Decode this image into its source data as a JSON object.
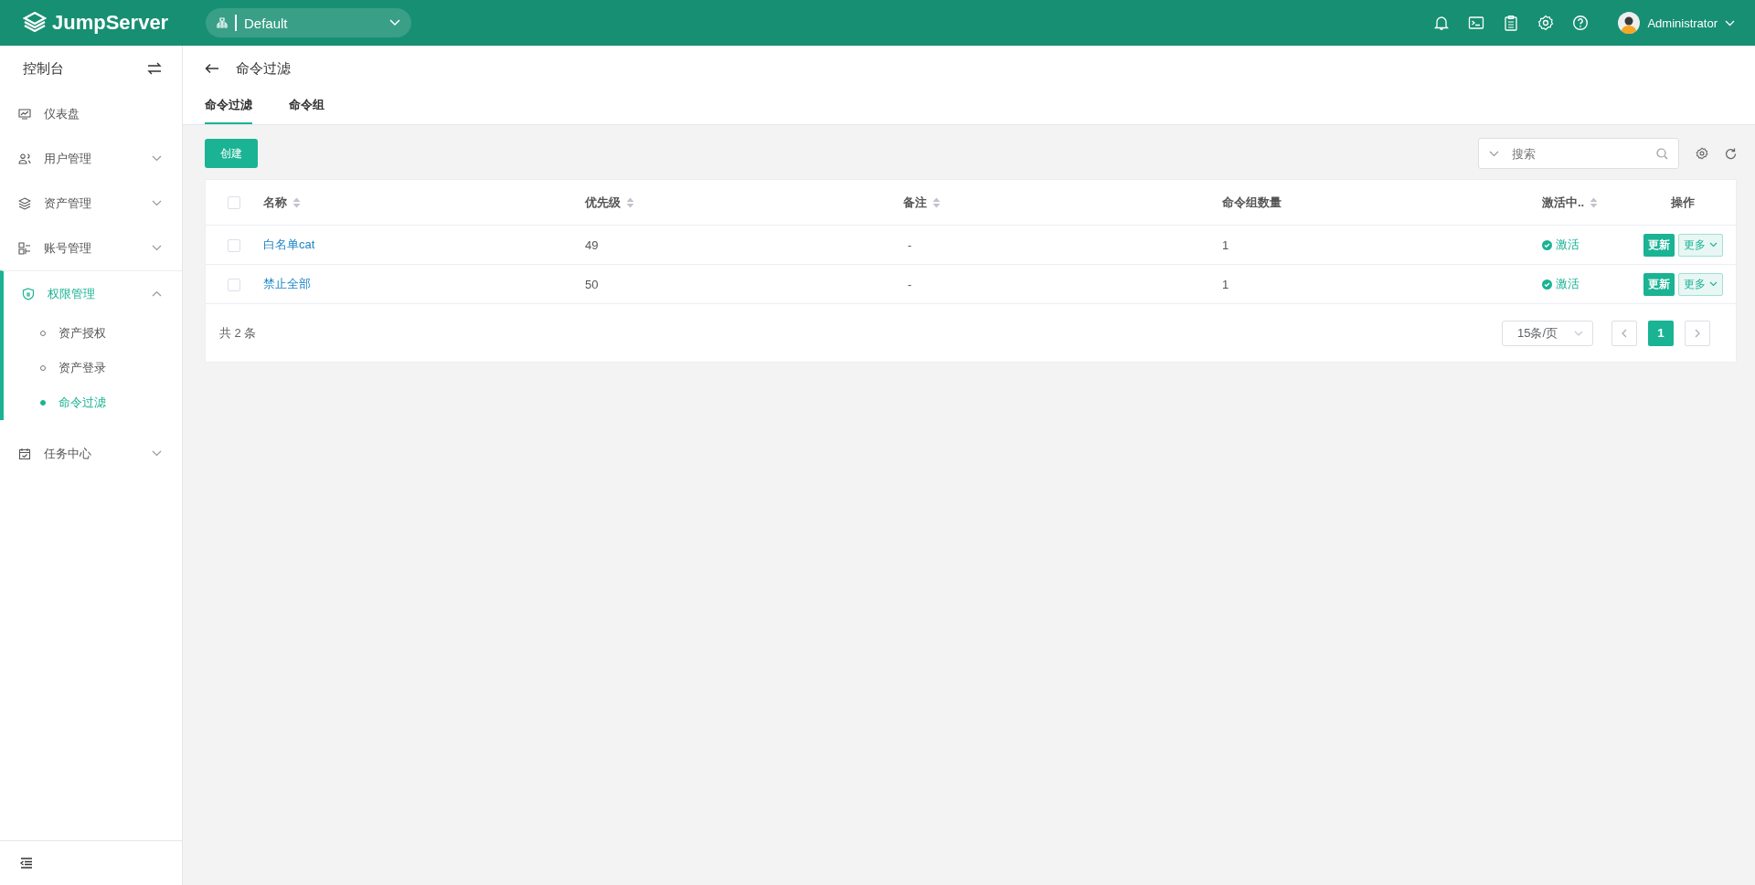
{
  "header": {
    "logo": "JumpServer",
    "org": "Default",
    "user": "Administrator"
  },
  "sidebar": {
    "title": "控制台",
    "items": [
      {
        "label": "仪表盘",
        "selected": false
      },
      {
        "label": "用户管理",
        "expanded": false,
        "selected": false
      },
      {
        "label": "资产管理",
        "expanded": false,
        "selected": false
      },
      {
        "label": "账号管理",
        "expanded": false,
        "selected": false
      },
      {
        "label": "权限管理",
        "expanded": true,
        "selected": true,
        "children": [
          {
            "label": "资产授权",
            "selected": false
          },
          {
            "label": "资产登录",
            "selected": false
          },
          {
            "label": "命令过滤",
            "selected": true
          }
        ]
      },
      {
        "label": "任务中心",
        "expanded": false,
        "selected": false
      }
    ]
  },
  "page": {
    "title": "命令过滤",
    "tabs": [
      {
        "label": "命令过滤",
        "selected": true
      },
      {
        "label": "命令组",
        "selected": false
      }
    ]
  },
  "toolbar": {
    "create": "创建",
    "search": {
      "placeholder": "搜索"
    }
  },
  "table": {
    "select_all": {
      "checked": false
    },
    "columns": [
      {
        "label": "名称",
        "sortable": true
      },
      {
        "label": "优先级",
        "sortable": true
      },
      {
        "label": "备注",
        "sortable": true
      },
      {
        "label": "命令组数量",
        "sortable": false
      },
      {
        "label": "激活中..",
        "sortable": true
      },
      {
        "label": "操作",
        "sortable": false
      }
    ],
    "rows": [
      {
        "checked": false,
        "name": "白名单cat",
        "priority": "49",
        "comment": "-",
        "count": "1",
        "status": "激活",
        "update": "更新",
        "more": "更多"
      },
      {
        "checked": false,
        "name": "禁止全部",
        "priority": "50",
        "comment": "-",
        "count": "1",
        "status": "激活",
        "update": "更新",
        "more": "更多"
      }
    ]
  },
  "pagination": {
    "total": "共 2 条",
    "page_size": "15条/页",
    "pages": [
      {
        "label": "1",
        "selected": true
      }
    ]
  }
}
